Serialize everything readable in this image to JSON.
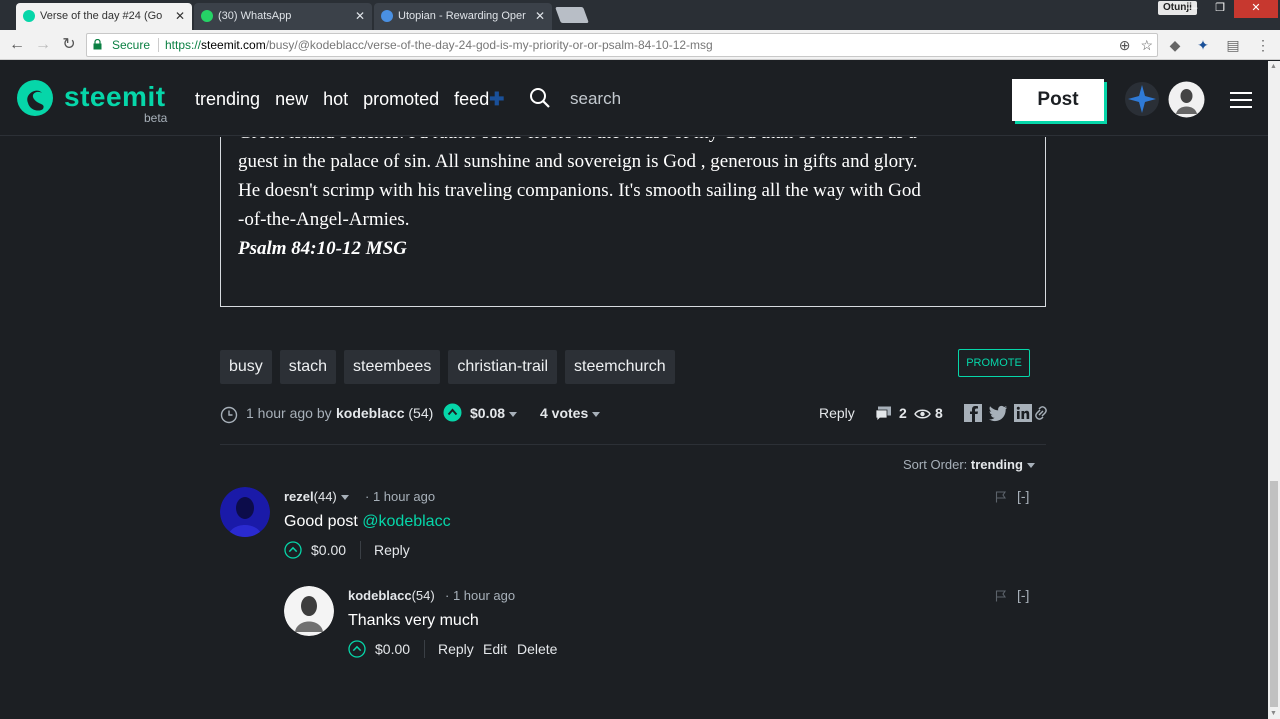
{
  "browser": {
    "tabs": [
      {
        "title": "Verse of the day #24 (Go",
        "active": true
      },
      {
        "title": "(30) WhatsApp",
        "active": false
      },
      {
        "title": "Utopian - Rewarding Oper",
        "active": false
      }
    ],
    "user": "Otunji",
    "secure_label": "Secure",
    "url_protocol": "https://",
    "url_host": "steemit.com",
    "url_path": "/busy/@kodeblacc/verse-of-the-day-24-god-is-my-priority-or-or-psalm-84-10-12-msg"
  },
  "header": {
    "logo_text": "steemit",
    "logo_beta": "beta",
    "nav": [
      "trending",
      "new",
      "hot",
      "promoted",
      "feed"
    ],
    "search_placeholder": "search",
    "post_label": "Post"
  },
  "post": {
    "quote_lines": [
      "Greek island beaches. I'd rather scrub floors in the house of my God than be honored as a",
      "guest in the palace of sin. All sunshine and sovereign is God , generous in gifts and glory.",
      "He doesn't scrimp with his traveling companions. It's smooth sailing all the way with God",
      "-of-the-Angel-Armies."
    ],
    "quote_ref": "Psalm 84:10-12 MSG",
    "tags": [
      "busy",
      "stach",
      "steembees",
      "christian-trail",
      "steemchurch"
    ],
    "promote_label": "PROMOTE",
    "time": "1 hour ago by",
    "author": "kodeblacc",
    "author_rep": "(54)",
    "payout": "$0.08",
    "votes": "4 votes",
    "reply_label": "Reply",
    "comment_count": "2",
    "view_count": "8"
  },
  "sort": {
    "label": "Sort Order:",
    "value": "trending"
  },
  "comments": [
    {
      "author": "rezel",
      "rep": "(44)",
      "time": "1 hour ago",
      "body_text": "Good post ",
      "mention": "@kodeblacc",
      "payout": "$0.00",
      "actions": [
        "Reply"
      ],
      "collapse": "[-]"
    },
    {
      "author": "kodeblacc",
      "rep": "(54)",
      "time": "1 hour ago",
      "body_text": "Thanks very much",
      "payout": "$0.00",
      "actions": [
        "Reply",
        "Edit",
        "Delete"
      ],
      "collapse": "[-]"
    }
  ],
  "colors": {
    "accent": "#06d6a9",
    "background": "#1c1f23",
    "tag_bg": "#2c3036"
  }
}
